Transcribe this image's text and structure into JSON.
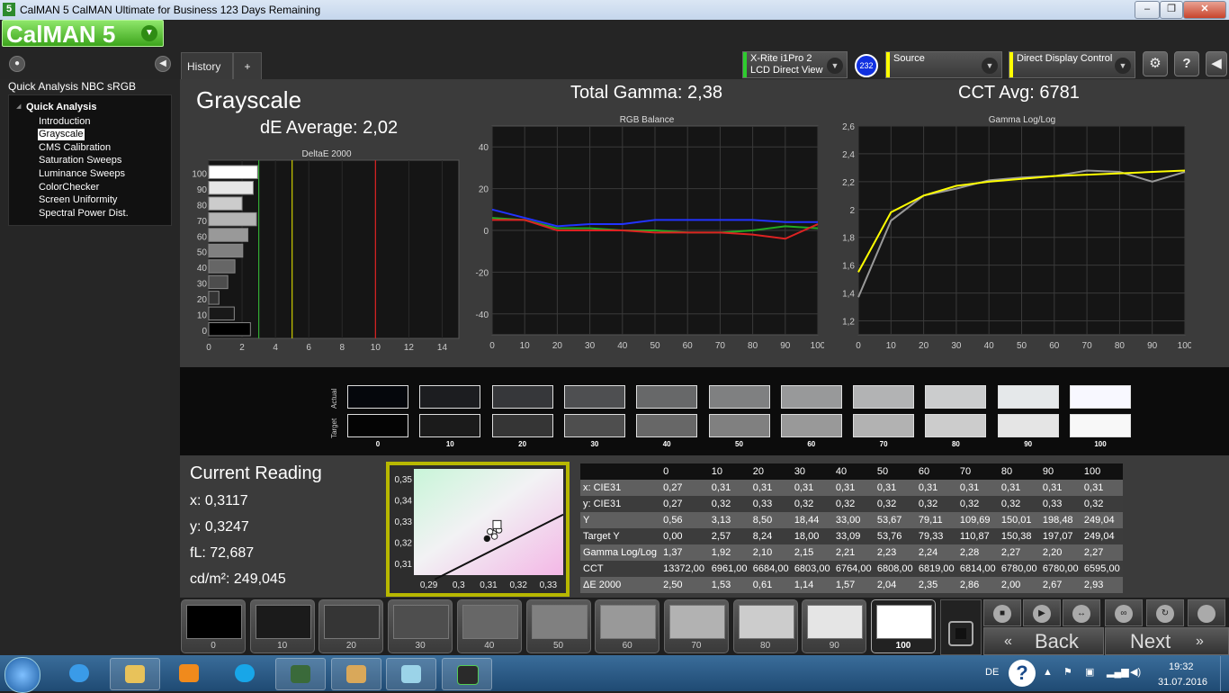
{
  "window": {
    "title": "CalMAN 5 CalMAN Ultimate for Business 123 Days Remaining",
    "app_icon": "5",
    "controls": [
      "minimize",
      "maximize",
      "close"
    ],
    "control_glyphs": {
      "minimize": "‒",
      "maximize": "❐",
      "close": "✕"
    }
  },
  "logo": {
    "text": "CalMAN 5",
    "menu_icon": "chevron-down-icon"
  },
  "tabs": [
    {
      "label": "History 1"
    },
    {
      "label": "+"
    }
  ],
  "devices": {
    "meter": {
      "line1": "X-Rite i1Pro 2",
      "line2": "LCD Direct View",
      "badge": "232",
      "accent": "#2ecc2e"
    },
    "source": {
      "label": "Source",
      "accent": "#ffff00"
    },
    "display": {
      "label": "Direct Display Control",
      "accent": "#ffff00"
    }
  },
  "toolbar": {
    "settings_icon": "gear-icon",
    "help_label": "?",
    "collapse_icon": "chevron-left-icon"
  },
  "sidebar": {
    "title": "Quick Analysis NBC sRGB",
    "root": "Quick Analysis",
    "items": [
      {
        "label": "Introduction",
        "selected": false
      },
      {
        "label": "Grayscale",
        "selected": true
      },
      {
        "label": "CMS Calibration",
        "selected": false
      },
      {
        "label": "Saturation Sweeps",
        "selected": false
      },
      {
        "label": "Luminance Sweeps",
        "selected": false
      },
      {
        "label": "ColorChecker",
        "selected": false
      },
      {
        "label": "Screen Uniformity",
        "selected": false
      },
      {
        "label": "Spectral Power Dist.",
        "selected": false
      }
    ]
  },
  "main": {
    "heading": "Grayscale",
    "de_average": "dE Average: 2,02",
    "total_gamma": "Total Gamma: 2,38",
    "cct_avg": "CCT Avg: 6781"
  },
  "chart_data": [
    {
      "type": "bar",
      "title": "DeltaE 2000",
      "orientation": "horizontal",
      "categories": [
        "100",
        "90",
        "80",
        "70",
        "60",
        "50",
        "40",
        "30",
        "20",
        "10",
        "0"
      ],
      "values": [
        2.93,
        2.67,
        2.0,
        2.86,
        2.35,
        2.04,
        1.57,
        1.14,
        0.61,
        1.53,
        2.5
      ],
      "xlim": [
        0,
        15
      ],
      "xticks": [
        "0",
        "2",
        "4",
        "6",
        "8",
        "10",
        "12",
        "14"
      ],
      "reference_lines": [
        {
          "value": 3,
          "color": "#33aa33"
        },
        {
          "value": 5,
          "color": "#cccc00"
        },
        {
          "value": 10,
          "color": "#dd2222"
        }
      ]
    },
    {
      "type": "line",
      "title": "RGB Balance",
      "x": [
        0,
        10,
        20,
        30,
        40,
        50,
        60,
        70,
        80,
        90,
        100
      ],
      "ylim": [
        -50,
        50
      ],
      "xticks": [
        "0",
        "10",
        "20",
        "30",
        "40",
        "50",
        "60",
        "70",
        "80",
        "90",
        "100"
      ],
      "yticks": [
        "40",
        "20",
        "0",
        "-20",
        "-40"
      ],
      "series": [
        {
          "color": "#2233ff",
          "values": [
            10,
            6,
            2,
            3,
            3,
            5,
            5,
            5,
            5,
            4,
            4
          ]
        },
        {
          "color": "#22aa22",
          "values": [
            6,
            5,
            1,
            1,
            0,
            0,
            -1,
            -1,
            0,
            2,
            1
          ]
        },
        {
          "color": "#dd2222",
          "values": [
            5,
            5,
            0,
            0,
            0,
            -1,
            -1,
            -1,
            -2,
            -4,
            3
          ]
        }
      ]
    },
    {
      "type": "line",
      "title": "Gamma Log/Log",
      "x": [
        0,
        10,
        20,
        30,
        40,
        50,
        60,
        70,
        80,
        90,
        100
      ],
      "ylim": [
        1.1,
        2.6
      ],
      "xticks": [
        "0",
        "10",
        "20",
        "30",
        "40",
        "50",
        "60",
        "70",
        "80",
        "90",
        "100"
      ],
      "yticks": [
        "2,6",
        "2,4",
        "2,2",
        "2",
        "1,8",
        "1,6",
        "1,4",
        "1,2"
      ],
      "series": [
        {
          "color": "#999999",
          "values": [
            1.37,
            1.92,
            2.1,
            2.15,
            2.21,
            2.23,
            2.24,
            2.28,
            2.27,
            2.2,
            2.27
          ]
        },
        {
          "color": "#ffff00",
          "values": [
            1.55,
            1.98,
            2.1,
            2.17,
            2.2,
            2.22,
            2.24,
            2.25,
            2.26,
            2.27,
            2.28
          ]
        }
      ]
    },
    {
      "type": "scatter",
      "xticks": [
        "0,29",
        "0,3",
        "0,31",
        "0,32",
        "0,33"
      ],
      "yticks": [
        "0,35",
        "0,34",
        "0,33",
        "0,32",
        "0,31"
      ],
      "xlim": [
        0.285,
        0.335
      ],
      "ylim": [
        0.305,
        0.355
      ],
      "points": [
        {
          "x": 0.3117,
          "y": 0.3247
        },
        {
          "x": 0.3125,
          "y": 0.327
        },
        {
          "x": 0.313,
          "y": 0.3285
        },
        {
          "x": 0.3135,
          "y": 0.3262
        },
        {
          "x": 0.3105,
          "y": 0.3255
        },
        {
          "x": 0.312,
          "y": 0.3232
        },
        {
          "x": 0.3095,
          "y": 0.3222
        }
      ],
      "target": {
        "x": 0.3127,
        "y": 0.329
      }
    }
  ],
  "swatches": {
    "labels": [
      "0",
      "10",
      "20",
      "30",
      "40",
      "50",
      "60",
      "70",
      "80",
      "90",
      "100"
    ],
    "actual_row_label": "Actual",
    "target_row_label": "Target",
    "actual_colors": [
      "#05070c",
      "#1c1d20",
      "#36373a",
      "#4e4f51",
      "#676869",
      "#7f8081",
      "#98999a",
      "#b2b3b4",
      "#cbcccd",
      "#e5e8ea",
      "#f8f8ff"
    ],
    "target_colors": [
      "#040404",
      "#1b1b1b",
      "#353535",
      "#4e4e4e",
      "#676767",
      "#808080",
      "#999999",
      "#b2b2b2",
      "#cccccc",
      "#e5e5e5",
      "#f8f8f8"
    ]
  },
  "reading": {
    "title": "Current Reading",
    "x": "x: 0,3117",
    "y": "y: 0,3247",
    "fl": "fL: 72,687",
    "cdm2": "cd/m²: 249,045"
  },
  "table": {
    "headers": [
      "",
      "0",
      "10",
      "20",
      "30",
      "40",
      "50",
      "60",
      "70",
      "80",
      "90",
      "100"
    ],
    "rows": [
      [
        "x: CIE31",
        "0,27",
        "0,31",
        "0,31",
        "0,31",
        "0,31",
        "0,31",
        "0,31",
        "0,31",
        "0,31",
        "0,31",
        "0,31"
      ],
      [
        "y: CIE31",
        "0,27",
        "0,32",
        "0,33",
        "0,32",
        "0,32",
        "0,32",
        "0,32",
        "0,32",
        "0,32",
        "0,33",
        "0,32"
      ],
      [
        "Y",
        "0,56",
        "3,13",
        "8,50",
        "18,44",
        "33,00",
        "53,67",
        "79,11",
        "109,69",
        "150,01",
        "198,48",
        "249,04"
      ],
      [
        "Target Y",
        "0,00",
        "2,57",
        "8,24",
        "18,00",
        "33,09",
        "53,76",
        "79,33",
        "110,87",
        "150,38",
        "197,07",
        "249,04"
      ],
      [
        "Gamma Log/Log",
        "1,37",
        "1,92",
        "2,10",
        "2,15",
        "2,21",
        "2,23",
        "2,24",
        "2,28",
        "2,27",
        "2,20",
        "2,27"
      ],
      [
        "CCT",
        "13372,00",
        "6961,00",
        "6684,00",
        "6803,00",
        "6764,00",
        "6808,00",
        "6819,00",
        "6814,00",
        "6780,00",
        "6780,00",
        "6595,00"
      ],
      [
        "ΔE 2000",
        "2,50",
        "1,53",
        "0,61",
        "1,14",
        "1,57",
        "2,04",
        "2,35",
        "2,86",
        "2,00",
        "2,67",
        "2,93"
      ]
    ]
  },
  "measure_buttons": [
    {
      "label": "0",
      "color": "#000000"
    },
    {
      "label": "10",
      "color": "#1b1b1b"
    },
    {
      "label": "20",
      "color": "#353535"
    },
    {
      "label": "30",
      "color": "#4e4e4e"
    },
    {
      "label": "40",
      "color": "#676767"
    },
    {
      "label": "50",
      "color": "#808080"
    },
    {
      "label": "60",
      "color": "#999999"
    },
    {
      "label": "70",
      "color": "#b2b2b2"
    },
    {
      "label": "80",
      "color": "#cccccc"
    },
    {
      "label": "90",
      "color": "#e5e5e5"
    },
    {
      "label": "100",
      "color": "#ffffff",
      "active": true
    }
  ],
  "controls": {
    "stop_icon": "stop-icon",
    "play_icon": "play-icon",
    "fit_icon": "fit-icon",
    "loop_icon": "infinity-icon",
    "refresh_icon": "refresh-icon",
    "back_label": "Back",
    "next_label": "Next"
  },
  "taskbar": {
    "language": "DE",
    "time": "19:32",
    "date": "31.07.2016",
    "apps": [
      "file-explorer-icon",
      "internet-explorer-icon",
      "media-player-icon",
      "skype-icon",
      "remote-desktop-icon",
      "paint-icon",
      "notepad-icon",
      "calman-icon"
    ]
  }
}
